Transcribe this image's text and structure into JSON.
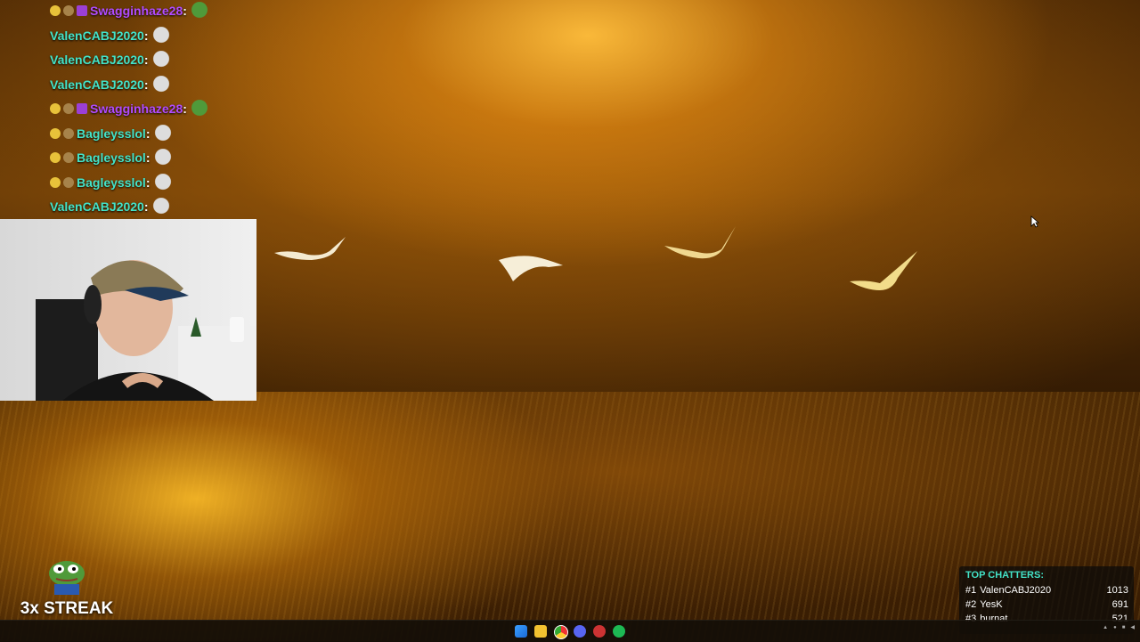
{
  "chat": {
    "messages": [
      {
        "user": "Swagginhaze28",
        "badges": [
          "gold",
          "bronze",
          "sub"
        ],
        "color": "#b04bff"
      },
      {
        "user": "ValenCABJ2020",
        "badges": [],
        "color": "#43e3c8"
      },
      {
        "user": "ValenCABJ2020",
        "badges": [],
        "color": "#43e3c8"
      },
      {
        "user": "ValenCABJ2020",
        "badges": [],
        "color": "#43e3c8"
      },
      {
        "user": "Swagginhaze28",
        "badges": [
          "gold",
          "bronze",
          "sub"
        ],
        "color": "#b04bff"
      },
      {
        "user": "Bagleysslol",
        "badges": [
          "gold",
          "bronze"
        ],
        "color": "#43e3c8"
      },
      {
        "user": "Bagleysslol",
        "badges": [
          "gold",
          "bronze"
        ],
        "color": "#43e3c8"
      },
      {
        "user": "Bagleysslol",
        "badges": [
          "gold",
          "bronze"
        ],
        "color": "#43e3c8"
      },
      {
        "user": "ValenCABJ2020",
        "badges": [],
        "color": "#43e3c8"
      }
    ],
    "separator": ":"
  },
  "streak": {
    "text": "3x STREAK"
  },
  "top_chatters": {
    "title": "TOP CHATTERS:",
    "rows": [
      {
        "rank": "#1",
        "name": "ValenCABJ2020",
        "count": "1013"
      },
      {
        "rank": "#2",
        "name": "YesK",
        "count": "691"
      },
      {
        "rank": "#3",
        "name": "burnat",
        "count": "521"
      }
    ]
  },
  "taskbar": {
    "icons": [
      "windows-start-icon",
      "file-explorer-icon",
      "chrome-icon",
      "discord-icon",
      "steam-icon",
      "spotify-icon"
    ]
  },
  "colors": {
    "accent_teal": "#43e3c8",
    "accent_purple": "#b04bff",
    "wallpaper_gold": "#e8a020"
  }
}
